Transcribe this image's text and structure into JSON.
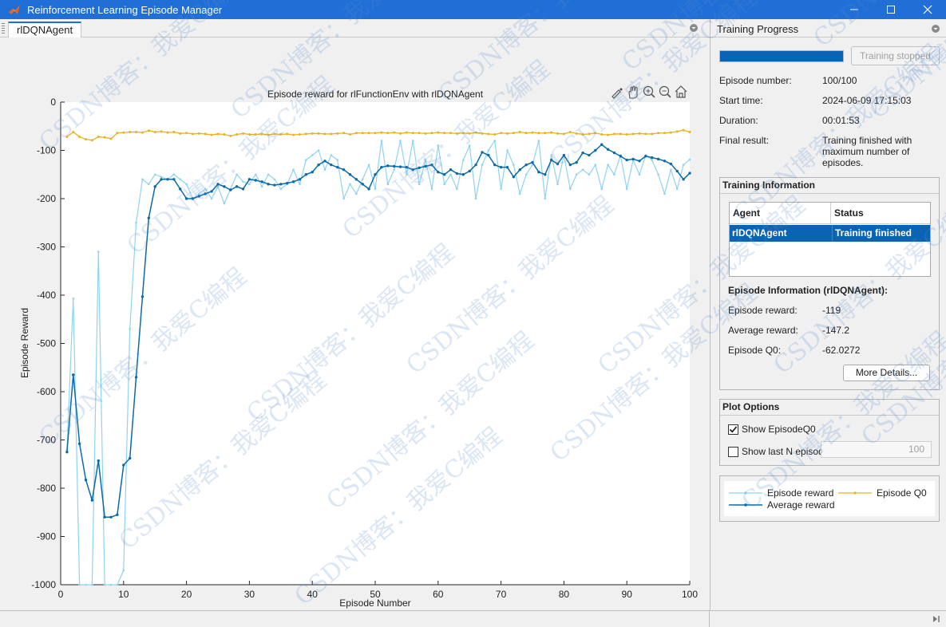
{
  "window": {
    "title": "Reinforcement Learning Episode Manager"
  },
  "document_tab": {
    "label": "rlDQNAgent"
  },
  "right_panel": {
    "header": "Training Progress",
    "progress": 1.0,
    "stop_button_label": "Training stopped",
    "info": [
      {
        "label": "Episode number:",
        "value": "100/100"
      },
      {
        "label": "Start time:",
        "value": "2024-06-09 17:15:03"
      },
      {
        "label": "Duration:",
        "value": "00:01:53"
      },
      {
        "label": "Final result:",
        "value": "Training finished with maximum number of episodes."
      }
    ],
    "training_information": {
      "title": "Training Information",
      "columns": [
        "Agent",
        "Status"
      ],
      "rows": [
        {
          "agent": "rlDQNAgent",
          "status": "Training finished"
        }
      ],
      "episode_info_title": "Episode Information (rlDQNAgent):",
      "episode_info": [
        {
          "label": "Episode reward:",
          "value": "-119"
        },
        {
          "label": "Average reward:",
          "value": "-147.2"
        },
        {
          "label": "Episode Q0:",
          "value": "-62.0272"
        }
      ],
      "more_details_label": "More Details..."
    },
    "plot_options": {
      "title": "Plot Options",
      "show_q0_label": "Show EpisodeQ0",
      "show_q0_checked": true,
      "show_last_n_label": "Show last N episodes",
      "show_last_n_checked": false,
      "last_n_value": "100"
    },
    "legend": {
      "episode_reward": "Episode reward",
      "episode_q0": "Episode Q0",
      "average_reward": "Average reward"
    }
  },
  "colors": {
    "episode_reward": "#8fd3f0",
    "average_reward": "#0b6aa8",
    "episode_q0": "#edb120",
    "accent": "#1f6fd6"
  },
  "watermark_text": "CSDN博客：我爱C编程",
  "chart_data": {
    "type": "line",
    "title": "Episode reward for rlFunctionEnv with rlDQNAgent",
    "xlabel": "Episode Number",
    "ylabel": "Episode Reward",
    "xlim": [
      0,
      100
    ],
    "ylim": [
      -1000,
      0
    ],
    "xticks": [
      0,
      10,
      20,
      30,
      40,
      50,
      60,
      70,
      80,
      90,
      100
    ],
    "yticks": [
      0,
      -100,
      -200,
      -300,
      -400,
      -500,
      -600,
      -700,
      -800,
      -900,
      -1000
    ],
    "x": [
      1,
      2,
      3,
      4,
      5,
      6,
      7,
      8,
      9,
      10,
      11,
      12,
      13,
      14,
      15,
      16,
      17,
      18,
      19,
      20,
      21,
      22,
      23,
      24,
      25,
      26,
      27,
      28,
      29,
      30,
      31,
      32,
      33,
      34,
      35,
      36,
      37,
      38,
      39,
      40,
      41,
      42,
      43,
      44,
      45,
      46,
      47,
      48,
      49,
      50,
      51,
      52,
      53,
      54,
      55,
      56,
      57,
      58,
      59,
      60,
      61,
      62,
      63,
      64,
      65,
      66,
      67,
      68,
      69,
      70,
      71,
      72,
      73,
      74,
      75,
      76,
      77,
      78,
      79,
      80,
      81,
      82,
      83,
      84,
      85,
      86,
      87,
      88,
      89,
      90,
      91,
      92,
      93,
      94,
      95,
      96,
      97,
      98,
      99,
      100
    ],
    "series": [
      {
        "name": "Episode reward",
        "values": [
          -720,
          -407,
          -1000,
          -1000,
          -1000,
          -310,
          -1000,
          -1000,
          -1000,
          -970,
          -470,
          -250,
          -160,
          -170,
          -150,
          -155,
          -160,
          -150,
          -160,
          -170,
          -200,
          -190,
          -180,
          -200,
          -175,
          -210,
          -180,
          -150,
          -165,
          -170,
          -150,
          -175,
          -150,
          -160,
          -180,
          -170,
          -140,
          -170,
          -120,
          -110,
          -100,
          -140,
          -110,
          -120,
          -200,
          -170,
          -190,
          -160,
          -130,
          -180,
          -80,
          -170,
          -140,
          -80,
          -150,
          -80,
          -170,
          -120,
          -180,
          -90,
          -170,
          -150,
          -180,
          -120,
          -90,
          -200,
          -130,
          -100,
          -80,
          -180,
          -100,
          -130,
          -190,
          -150,
          -130,
          -80,
          -200,
          -110,
          -170,
          -110,
          -180,
          -150,
          -140,
          -150,
          -130,
          -180,
          -130,
          -150,
          -110,
          -180,
          -120,
          -150,
          -110,
          -120,
          -150,
          -190,
          -140,
          -180,
          -130,
          -119
        ]
      },
      {
        "name": "Average reward",
        "values": [
          -725,
          -565,
          -708,
          -783,
          -825,
          -743,
          -860,
          -860,
          -855,
          -752,
          -738,
          -570,
          -403,
          -240,
          -175,
          -160,
          -160,
          -160,
          -180,
          -200,
          -200,
          -195,
          -190,
          -185,
          -170,
          -175,
          -182,
          -175,
          -180,
          -160,
          -162,
          -165,
          -170,
          -172,
          -170,
          -168,
          -165,
          -160,
          -150,
          -145,
          -130,
          -122,
          -130,
          -135,
          -140,
          -150,
          -160,
          -170,
          -180,
          -150,
          -135,
          -132,
          -133,
          -134,
          -135,
          -140,
          -136,
          -133,
          -130,
          -145,
          -150,
          -140,
          -148,
          -150,
          -143,
          -130,
          -104,
          -110,
          -130,
          -135,
          -135,
          -155,
          -140,
          -130,
          -125,
          -145,
          -150,
          -120,
          -128,
          -110,
          -130,
          -125,
          -105,
          -110,
          -100,
          -88,
          -98,
          -105,
          -112,
          -120,
          -118,
          -122,
          -112,
          -115,
          -118,
          -122,
          -128,
          -143,
          -160,
          -147.2
        ]
      },
      {
        "name": "Episode Q0",
        "values": [
          -72,
          -62,
          -72,
          -77,
          -79,
          -72,
          -73,
          -76,
          -64,
          -63,
          -62,
          -62,
          -63,
          -59,
          -62,
          -61,
          -63,
          -62,
          -65,
          -64,
          -66,
          -65,
          -66,
          -68,
          -66,
          -67,
          -70,
          -67,
          -65,
          -67,
          -67,
          -66,
          -68,
          -66,
          -67,
          -66,
          -68,
          -67,
          -66,
          -65,
          -65,
          -66,
          -66,
          -65,
          -64,
          -67,
          -64,
          -64,
          -64,
          -64,
          -63,
          -64,
          -63,
          -65,
          -63,
          -64,
          -64,
          -65,
          -64,
          -63,
          -64,
          -64,
          -65,
          -64,
          -65,
          -63,
          -65,
          -66,
          -67,
          -64,
          -65,
          -64,
          -62,
          -64,
          -63,
          -64,
          -64,
          -63,
          -65,
          -66,
          -62,
          -65,
          -67,
          -66,
          -64,
          -67,
          -68,
          -66,
          -66,
          -67,
          -66,
          -65,
          -66,
          -66,
          -64,
          -64,
          -63,
          -61,
          -58,
          -62.03
        ]
      }
    ]
  }
}
